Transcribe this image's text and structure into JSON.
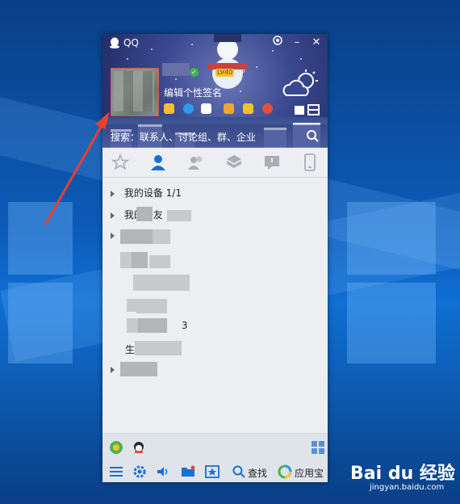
{
  "window": {
    "title": "QQ",
    "level_badge": "LV40",
    "vip_badge": "VIP",
    "signature": "编辑个性签名",
    "search_placeholder": "搜索：联系人、讨论组、群、企业"
  },
  "contact_groups": [
    {
      "label": "我的设备",
      "count": "1/1"
    },
    {
      "label": "我的好友",
      "count": ""
    },
    {
      "label": "",
      "count": ""
    },
    {
      "label": "",
      "count": ""
    },
    {
      "label": "",
      "count": ""
    },
    {
      "label": "",
      "count": "3"
    },
    {
      "label": "生",
      "count": ""
    },
    {
      "label": "",
      "count": ""
    }
  ],
  "bottom_bar": {
    "find_label": "查找",
    "appstore_label": "应用宝"
  },
  "watermark": {
    "brand": "Bai du 经验",
    "url": "jingyan.baidu.com"
  },
  "colors": {
    "accent": "#1a6fd0",
    "header_dark": "#1f2a63",
    "arrow": "#e8412f",
    "online": "#3fb34f"
  }
}
